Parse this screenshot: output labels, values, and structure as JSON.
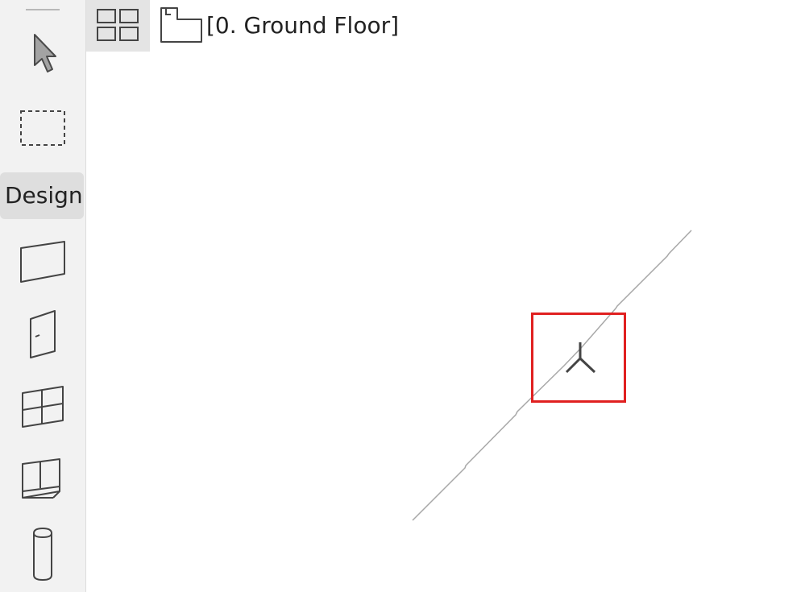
{
  "toolbox": {
    "palette_label": "Design",
    "tools": [
      {
        "name": "arrow-tool",
        "icon": "arrow-pointer-icon"
      },
      {
        "name": "marquee-tool",
        "icon": "dashed-rectangle-icon"
      },
      {
        "name": "wall-tool",
        "icon": "wall-icon"
      },
      {
        "name": "door-tool",
        "icon": "door-icon"
      },
      {
        "name": "window-tool",
        "icon": "window-icon"
      },
      {
        "name": "corner-window-tool",
        "icon": "corner-window-icon"
      },
      {
        "name": "column-tool",
        "icon": "column-icon"
      }
    ]
  },
  "view": {
    "switch_icon": "grid-view-icon",
    "story_icon": "floor-plan-icon",
    "title": "[0. Ground Floor]"
  },
  "colors": {
    "highlight": "#e02020",
    "line": "#a8a8a8",
    "cursor": "#444444"
  }
}
